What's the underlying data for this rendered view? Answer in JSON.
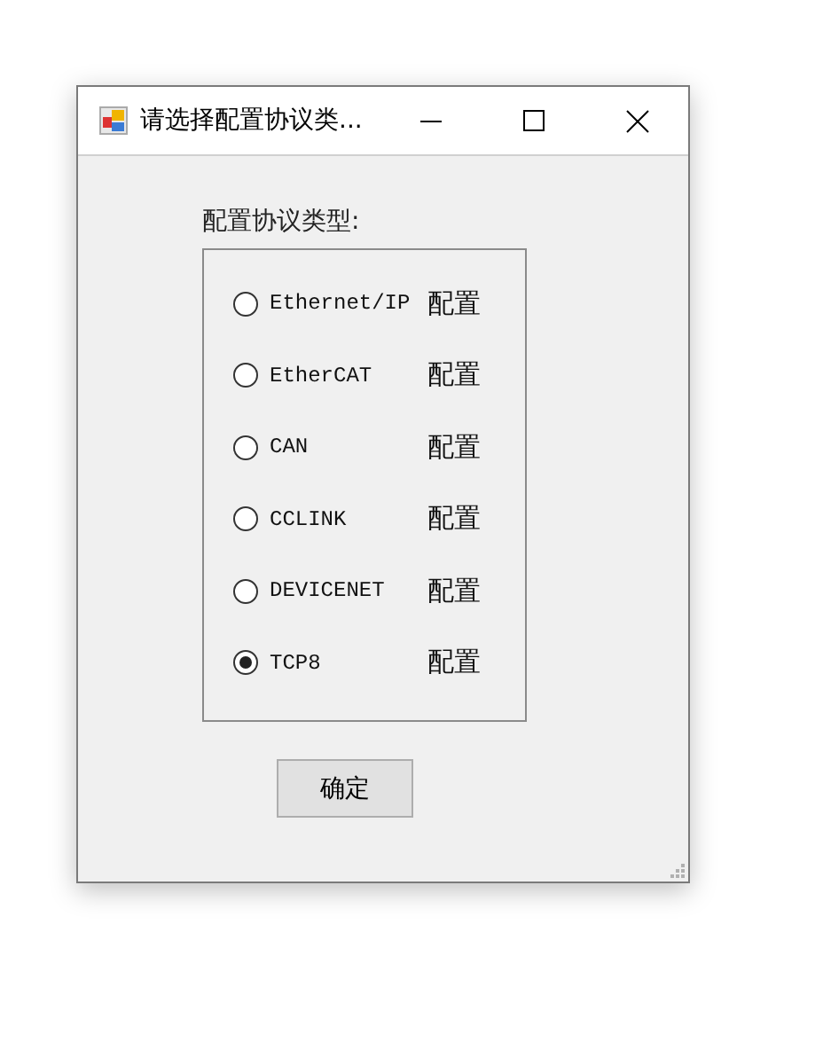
{
  "window": {
    "title": "请选择配置协议类..."
  },
  "group_label": "配置协议类型:",
  "options": [
    {
      "label": "Ethernet/IP",
      "selected": false,
      "action": "配置"
    },
    {
      "label": "EtherCAT",
      "selected": false,
      "action": "配置"
    },
    {
      "label": "CAN",
      "selected": false,
      "action": "配置"
    },
    {
      "label": "CCLINK",
      "selected": false,
      "action": "配置"
    },
    {
      "label": "DEVICENET",
      "selected": false,
      "action": "配置"
    },
    {
      "label": "TCP8",
      "selected": true,
      "action": "配置"
    }
  ],
  "buttons": [
    "确定"
  ]
}
